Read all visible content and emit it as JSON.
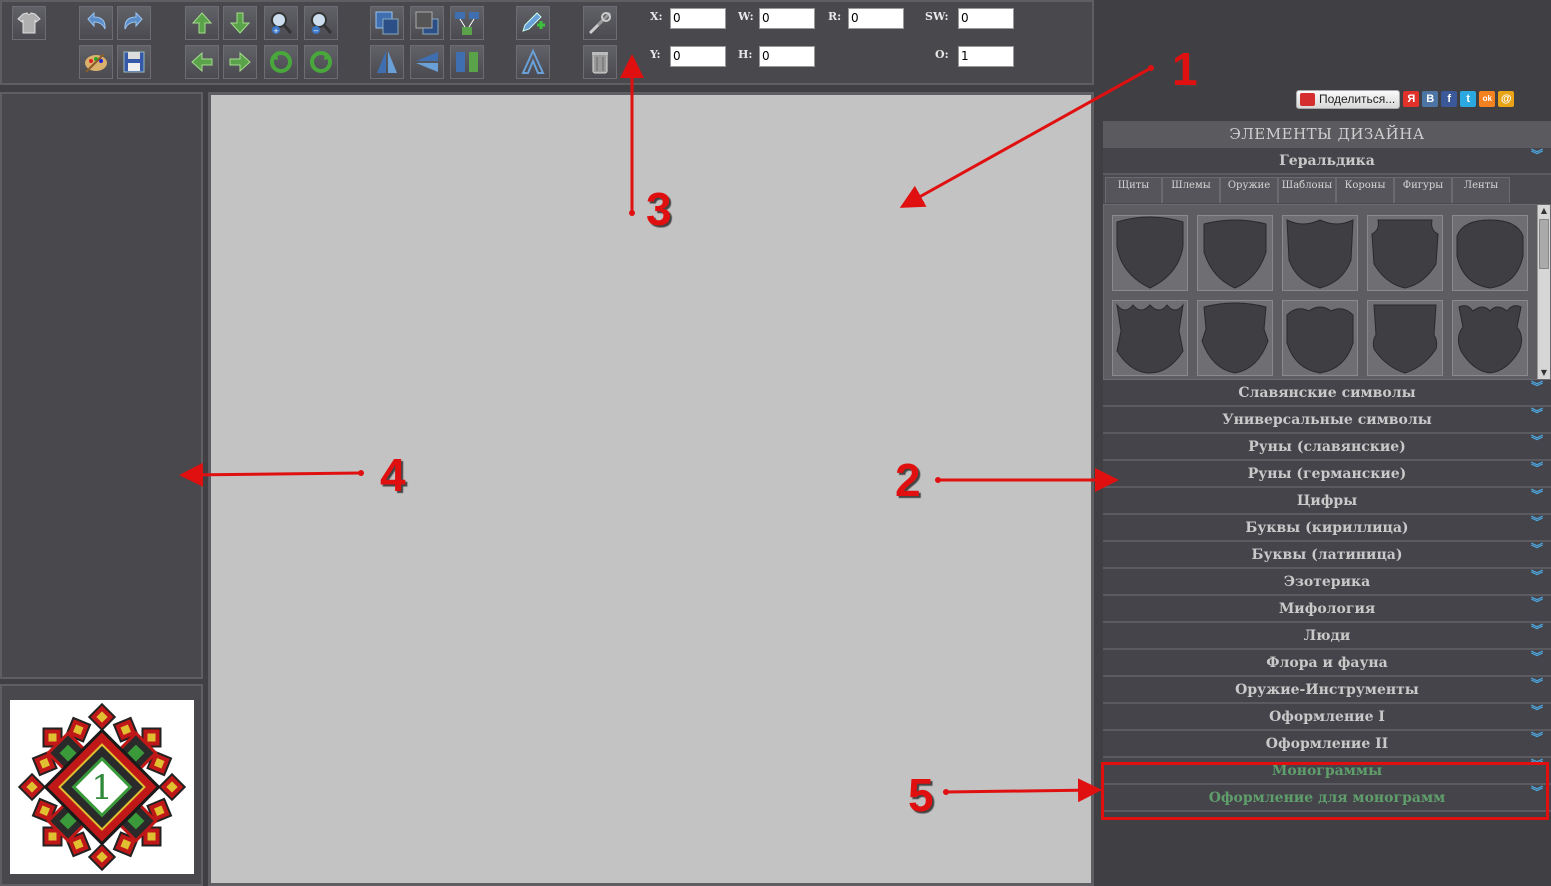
{
  "toolbar": {
    "buttons": [
      {
        "name": "shirt-icon"
      },
      {
        "name": "undo-icon"
      },
      {
        "name": "redo-icon"
      },
      {
        "name": "palette-icon"
      },
      {
        "name": "save-icon"
      },
      {
        "name": "move-up-icon"
      },
      {
        "name": "move-down-icon"
      },
      {
        "name": "zoom-in-icon"
      },
      {
        "name": "zoom-out-icon"
      },
      {
        "name": "move-left-icon"
      },
      {
        "name": "move-right-icon"
      },
      {
        "name": "rotate-left-icon"
      },
      {
        "name": "rotate-right-icon"
      },
      {
        "name": "bring-front-icon"
      },
      {
        "name": "send-back-icon"
      },
      {
        "name": "group-icon"
      },
      {
        "name": "flip-vertical-icon"
      },
      {
        "name": "flip-horizontal-icon"
      },
      {
        "name": "ungroup-icon"
      },
      {
        "name": "edit-add-icon"
      },
      {
        "name": "text-icon"
      },
      {
        "name": "tools-icon"
      },
      {
        "name": "trash-icon"
      }
    ],
    "fields": {
      "x": {
        "label": "X:",
        "value": "0"
      },
      "y": {
        "label": "Y:",
        "value": "0"
      },
      "w": {
        "label": "W:",
        "value": "0"
      },
      "h": {
        "label": "H:",
        "value": "0"
      },
      "r": {
        "label": "R:",
        "value": "0"
      },
      "sw": {
        "label": "SW:",
        "value": "0"
      },
      "o": {
        "label": "O:",
        "value": "1"
      }
    }
  },
  "share": {
    "button_label": "Поделиться...",
    "icons": [
      {
        "name": "yandex-icon",
        "glyph": "Я",
        "color": "#e0312b"
      },
      {
        "name": "vkontakte-icon",
        "glyph": "В",
        "color": "#4c75a3"
      },
      {
        "name": "facebook-icon",
        "glyph": "f",
        "color": "#3b5998"
      },
      {
        "name": "twitter-icon",
        "glyph": "t",
        "color": "#2ba8e0"
      },
      {
        "name": "odnoklassniki-icon",
        "glyph": "ok",
        "color": "#f58220"
      },
      {
        "name": "mail-icon",
        "glyph": "@",
        "color": "#e8a317"
      }
    ]
  },
  "right_panel": {
    "title": "ЭЛЕМЕНТЫ ДИЗАЙНА",
    "open_section": "Геральдика",
    "tabs": [
      "Щиты",
      "Шлемы",
      "Оружие",
      "Шаблоны",
      "Короны",
      "Фигуры",
      "Ленты"
    ],
    "sections": [
      "Славянские символы",
      "Универсальные символы",
      "Руны (славянские)",
      "Руны (германские)",
      "Цифры",
      "Буквы (кириллица)",
      "Буквы (латиница)",
      "Эзотерика",
      "Мифология",
      "Люди",
      "Флора и фауна",
      "Оружие-Инструменты",
      "Оформление I",
      "Оформление II"
    ],
    "highlighted_sections": [
      "Монограммы",
      "Оформление для монограмм"
    ],
    "shield_count": 10,
    "accent_color": "#5f9e6b"
  },
  "annotations": {
    "labels": [
      "1",
      "2",
      "3",
      "4",
      "5"
    ],
    "color": "#e01010"
  }
}
